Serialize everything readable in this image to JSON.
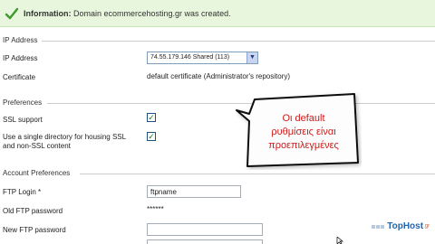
{
  "info": {
    "label": "Information:",
    "message": " Domain ecommercehosting.gr was created."
  },
  "sections": {
    "ip_address": "IP Address",
    "preferences": "Preferences",
    "account_preferences": "Account Preferences"
  },
  "ip": {
    "ip_label": "IP Address",
    "ip_value": "74.55.179.146 Shared (113)",
    "cert_label": "Certificate",
    "cert_value": "default certificate (Administrator's repository)"
  },
  "prefs": {
    "ssl_label": "SSL support",
    "ssl_checked": true,
    "single_dir_label_1": "Use a single directory for housing SSL",
    "single_dir_label_2": "and non-SSL content",
    "single_dir_checked": true
  },
  "account": {
    "ftp_login_label": "FTP Login *",
    "ftp_login_value": "ftpname",
    "old_pw_label": "Old FTP password",
    "old_pw_value": "******",
    "new_pw_label": "New FTP password"
  },
  "callout": {
    "line1": "Οι default",
    "line2": "ρυθμίσεις είναι",
    "line3": "προεπιλεγμένες"
  },
  "logo": {
    "name": "TopHost",
    "tld": ".gr"
  },
  "colors": {
    "info_bg": "#e7f6dd",
    "callout_text": "#cc1b1b",
    "logo_blue": "#2264b0"
  }
}
